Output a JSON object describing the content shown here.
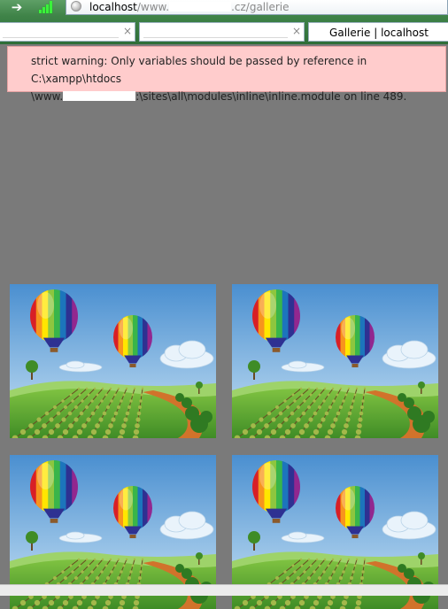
{
  "browser": {
    "address": {
      "host": "localhost",
      "path_prefix": "/www.",
      "path_suffix": ".cz/gallerie"
    },
    "tabs": [
      {
        "title": ""
      },
      {
        "title": ""
      },
      {
        "title": "Gallerie | localhost",
        "active": true
      }
    ],
    "close_glyph": "×"
  },
  "message": {
    "line1": "strict warning: Only variables should be passed by reference in C:\\xampp\\htdocs",
    "line2_prefix": "\\www.",
    "line2_suffix": ":\\sites\\all\\modules\\inline\\inline.module on line 489."
  },
  "gallery": {
    "images": [
      {
        "name": "balloons-1"
      },
      {
        "name": "balloons-2"
      },
      {
        "name": "balloons-3"
      },
      {
        "name": "balloons-4"
      }
    ]
  },
  "colors": {
    "page_background": "#7a7a7a",
    "message_background": "#ffcccc",
    "chrome_green": "#3f8348"
  }
}
